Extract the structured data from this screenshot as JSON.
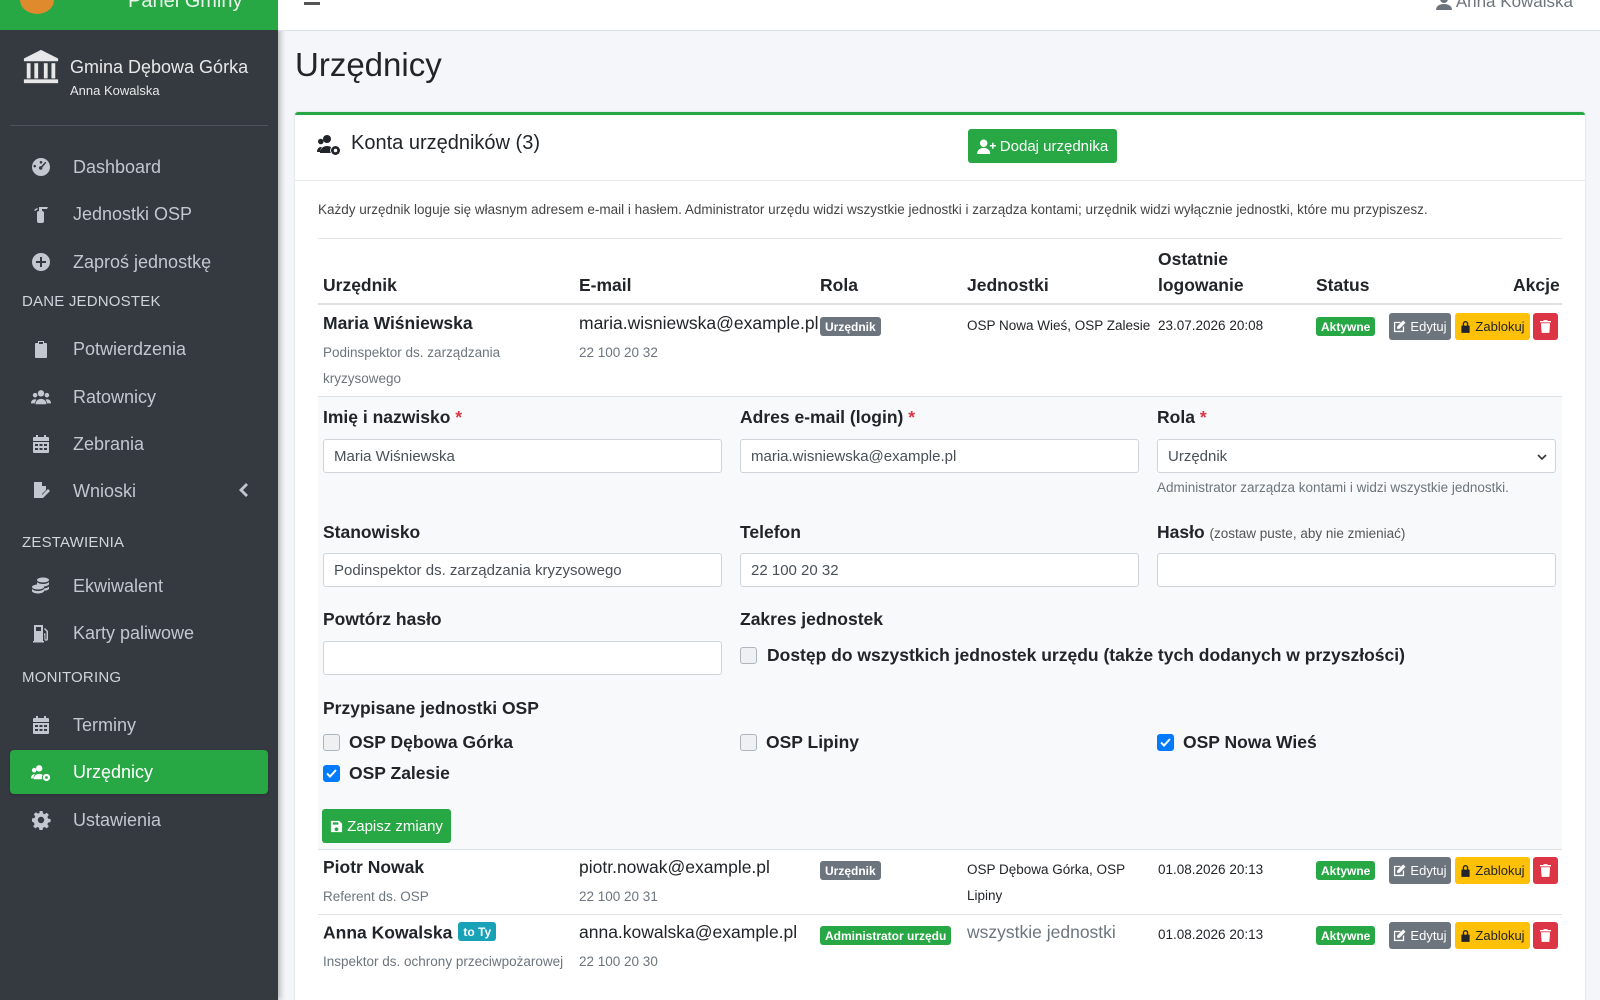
{
  "app": {
    "brand_text": "Panel Gminy",
    "org_name": "Gmina Dębowa Górka",
    "user_name": "Anna Kowalska",
    "top_user": "Anna Kowalska"
  },
  "sidebar": {
    "items": [
      {
        "label": "Dashboard",
        "icon": "dashboard-icon"
      },
      {
        "label": "Jednostki OSP",
        "icon": "fire-extinguisher-icon"
      },
      {
        "label": "Zaproś jednostkę",
        "icon": "plus-circle-icon"
      }
    ],
    "section_data": "DANE JEDNOSTEK",
    "data_items": [
      {
        "label": "Potwierdzenia",
        "icon": "clipboard-icon"
      },
      {
        "label": "Ratownicy",
        "icon": "users-icon"
      },
      {
        "label": "Zebrania",
        "icon": "calendar-icon"
      },
      {
        "label": "Wnioski",
        "icon": "file-signature-icon"
      }
    ],
    "section_reports": "ZESTAWIENIA",
    "report_items": [
      {
        "label": "Ekwiwalent",
        "icon": "coins-icon"
      },
      {
        "label": "Karty paliwowe",
        "icon": "gas-pump-icon"
      }
    ],
    "section_monitoring": "MONITORING",
    "monitoring_items": [
      {
        "label": "Terminy",
        "icon": "calendar-icon"
      },
      {
        "label": "Urzędnicy",
        "icon": "users-cog-icon",
        "active": true
      },
      {
        "label": "Ustawienia",
        "icon": "gear-icon"
      }
    ]
  },
  "page": {
    "title": "Urzędnicy",
    "card_title": "Konta urzędników (3)",
    "add_button": "Dodaj urzędnika",
    "info": "Każdy urzędnik loguje się własnym adresem e-mail i hasłem. Administrator urzędu widzi wszystkie jednostki i zarządza kontami; urzędnik widzi wyłącznie jednostki, które mu przypiszesz."
  },
  "table": {
    "headers": {
      "official": "Urzędnik",
      "email": "E-mail",
      "role": "Rola",
      "units": "Jednostki",
      "last_login_1": "Ostatnie",
      "last_login_2": "logowanie",
      "status": "Status",
      "actions": "Akcje"
    },
    "edit_label": "Edytuj",
    "lock_label": "Zablokuj",
    "rows": [
      {
        "name": "Maria Wiśniewska",
        "position_1": "Podinspektor ds. zarządzania",
        "position_2": "kryzysowego",
        "email": "maria.wisniewska@example.pl",
        "phone": "22 100 20 32",
        "role": "Urzędnik",
        "units": "OSP Nowa Wieś, OSP Zalesie",
        "last_login": "23.07.2026 20:08",
        "status": "Aktywne"
      },
      {
        "name": "Piotr Nowak",
        "position_1": "Referent ds. OSP",
        "email": "piotr.nowak@example.pl",
        "phone": "22 100 20 31",
        "role": "Urzędnik",
        "units_1": "OSP Dębowa Górka, OSP",
        "units_2": "Lipiny",
        "last_login": "01.08.2026 20:13",
        "status": "Aktywne"
      },
      {
        "name": "Anna Kowalska",
        "you_badge": "to Ty",
        "position_1": "Inspektor ds. ochrony przeciwpożarowej",
        "email": "anna.kowalska@example.pl",
        "phone": "22 100 20 30",
        "role": "Administrator urzędu",
        "units": "wszystkie jednostki",
        "last_login": "01.08.2026 20:13",
        "status": "Aktywne"
      }
    ]
  },
  "form": {
    "name_label": "Imię i nazwisko",
    "name_value": "Maria Wiśniewska",
    "email_label": "Adres e-mail (login)",
    "email_value": "maria.wisniewska@example.pl",
    "role_label": "Rola",
    "role_value": "Urzędnik",
    "role_help": "Administrator zarządza kontami i widzi wszystkie jednostki.",
    "position_label": "Stanowisko",
    "position_value": "Podinspektor ds. zarządzania kryzysowego",
    "phone_label": "Telefon",
    "phone_value": "22 100 20 32",
    "password_label": "Hasło",
    "password_hint": "(zostaw puste, aby nie zmieniać)",
    "password_value": "",
    "repeat_label": "Powtórz hasło",
    "repeat_value": "",
    "scope_label": "Zakres jednostek",
    "scope_checkbox": "Dostęp do wszystkich jednostek urzędu (także tych dodanych w przyszłości)",
    "scope_checked": false,
    "assigned_label": "Przypisane jednostki OSP",
    "units": [
      {
        "label": "OSP Dębowa Górka",
        "checked": false
      },
      {
        "label": "OSP Lipiny",
        "checked": false
      },
      {
        "label": "OSP Nowa Wieś",
        "checked": true
      },
      {
        "label": "OSP Zalesie",
        "checked": true
      }
    ],
    "save_button": "Zapisz zmiany"
  },
  "colors": {
    "accent": "#28a745",
    "sidebar_bg": "#343a40",
    "warning": "#ffc107",
    "danger": "#dc3545",
    "info": "#17a2b8",
    "checkbox": "#007bff"
  }
}
